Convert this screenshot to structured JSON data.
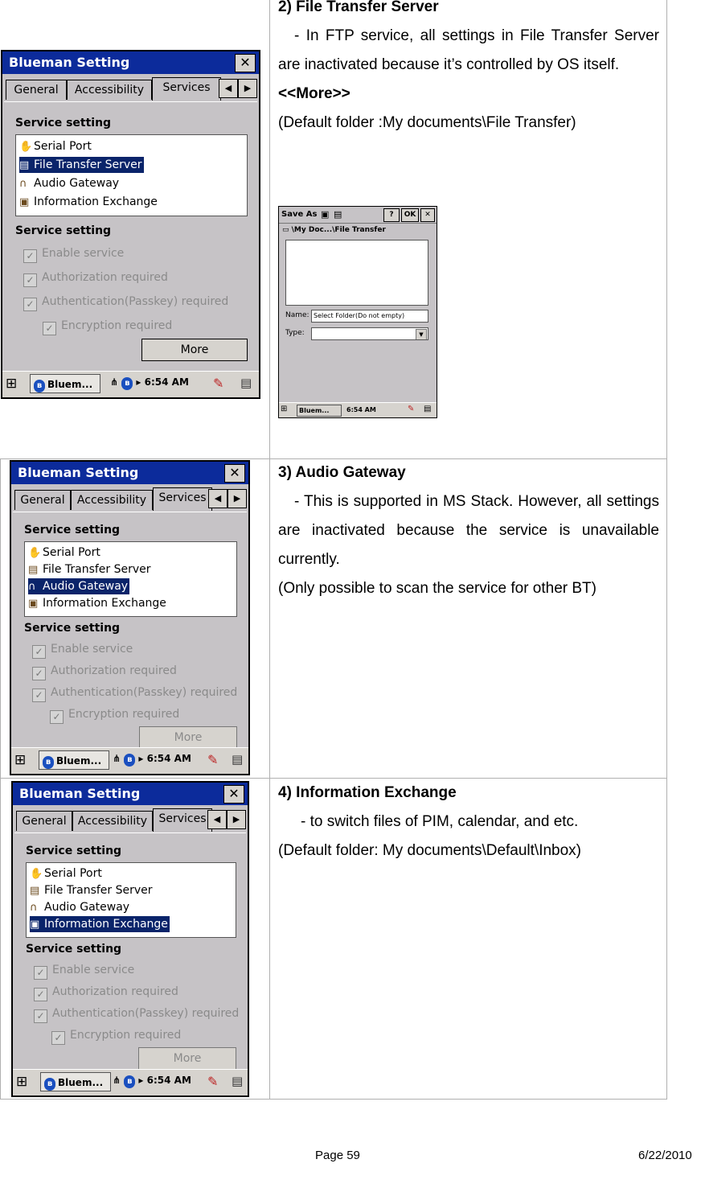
{
  "sections": [
    {
      "heading": "2) File Transfer Server",
      "paragraph": "- In FTP service, all settings in File Transfer Server are inactivated because it’s controlled by OS itself.",
      "extra_bold": "<<More>>",
      "extra_line": "(Default folder :My documents\\File Transfer)"
    },
    {
      "heading": "3) Audio Gateway",
      "paragraph": "- This is supported in MS Stack. However, all settings are inactivated because the service is unavailable currently.",
      "extra_line": "(Only possible to scan the service for other BT)"
    },
    {
      "heading": "4) Information Exchange",
      "paragraph": "- to switch files of PIM, calendar, and etc.",
      "extra_line": "(Default folder: My documents\\Default\\Inbox)"
    }
  ],
  "dialog": {
    "title": "Blueman Setting",
    "close": "✕",
    "tabs": [
      "General",
      "Accessibility",
      "Services"
    ],
    "arrow_left": "◀",
    "arrow_right": "▶",
    "section_label": "Service setting",
    "services": [
      "Serial Port",
      "File Transfer Server",
      "Audio Gateway",
      "Information Exchange"
    ],
    "checks": [
      "Enable service",
      "Authorization required",
      "Authentication(Passkey) required",
      "Encryption required"
    ],
    "more": "More",
    "taskbar_task": "Bluem...",
    "time": "6:54 AM"
  },
  "save_as": {
    "title": "Save As",
    "help": "?",
    "ok": "OK",
    "close": "✕",
    "path": "\\My Doc...\\File Transfer",
    "name_label": "Name:",
    "name_value": "Select Folder(Do not empty)",
    "type_label": "Type:",
    "type_value": ""
  },
  "selected_service": [
    "File Transfer Server",
    "Audio Gateway",
    "Information Exchange"
  ],
  "footer": {
    "page": "Page 59",
    "date": "6/22/2010"
  }
}
